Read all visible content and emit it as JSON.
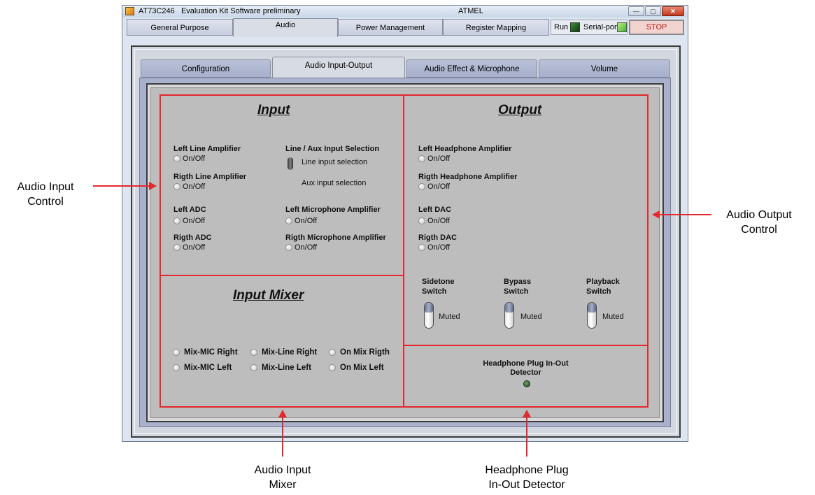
{
  "window": {
    "title": "AT73C246   Evaluation Kit Software preliminary",
    "title_center": "ATMEL",
    "controls": {
      "minimize": "—",
      "maximize": "▢",
      "close": "✕"
    }
  },
  "top_tabs": [
    {
      "label": "General Purpose",
      "active": false
    },
    {
      "label": "Audio",
      "active": true
    },
    {
      "label": "Power Management",
      "active": false
    },
    {
      "label": "Register Mapping",
      "active": false
    }
  ],
  "status": {
    "run_label": "Run",
    "serial_label": "Serial-port",
    "stop_label": "STOP",
    "run_led_color": "#1f6b1f",
    "serial_led_color": "#7ad65a"
  },
  "sub_tabs": [
    {
      "label": "Configuration",
      "active": false
    },
    {
      "label": "Audio Input-Output",
      "active": true
    },
    {
      "label": "Audio Effect & Microphone",
      "active": false
    },
    {
      "label": "Volume",
      "active": false
    }
  ],
  "input": {
    "title": "Input",
    "left_line_amp": {
      "label": "Left Line Amplifier",
      "option": "On/Off"
    },
    "right_line_amp": {
      "label": "Rigth Line Amplifier",
      "option": "On/Off"
    },
    "left_adc": {
      "label": "Left ADC",
      "option": "On/Off"
    },
    "right_adc": {
      "label": "Rigth ADC",
      "option": "On/Off"
    },
    "line_aux": {
      "label": "Line / Aux Input Selection",
      "line": "Line input selection",
      "aux": "Aux input selection"
    },
    "left_mic_amp": {
      "label": "Left Microphone Amplifier",
      "option": "On/Off"
    },
    "right_mic_amp": {
      "label": "Rigth Microphone Amplifier",
      "option": "On/Off"
    }
  },
  "mixer": {
    "title": "Input Mixer",
    "row1": [
      "Mix-MIC Right",
      "Mix-Line Right",
      "On Mix Rigth"
    ],
    "row2": [
      "Mix-MIC Left",
      "Mix-Line Left",
      "On Mix Left"
    ]
  },
  "output": {
    "title": "Output",
    "left_hp_amp": {
      "label": "Left Headphone Amplifier",
      "option": "On/Off"
    },
    "right_hp_amp": {
      "label": "Rigth Headphone Amplifier",
      "option": "On/Off"
    },
    "left_dac": {
      "label": "Left DAC",
      "option": "On/Off"
    },
    "right_dac": {
      "label": "Rigth DAC",
      "option": "On/Off"
    },
    "switches": [
      {
        "label1": "Sidetone",
        "label2": "Switch",
        "state": "Muted"
      },
      {
        "label1": "Bypass",
        "label2": "Switch",
        "state": "Muted"
      },
      {
        "label1": "Playback",
        "label2": "Switch",
        "state": "Muted"
      }
    ]
  },
  "detector": {
    "label1": "Headphone Plug In-Out",
    "label2": "Detector"
  },
  "annotations": {
    "input_control": [
      "Audio Input",
      "Control"
    ],
    "output_control": [
      "Audio Output",
      "Control"
    ],
    "input_mixer": [
      "Audio Input",
      "Mixer"
    ],
    "hp_detector": [
      "Headphone Plug",
      "In-Out Detector"
    ],
    "color": "#e3282e"
  }
}
